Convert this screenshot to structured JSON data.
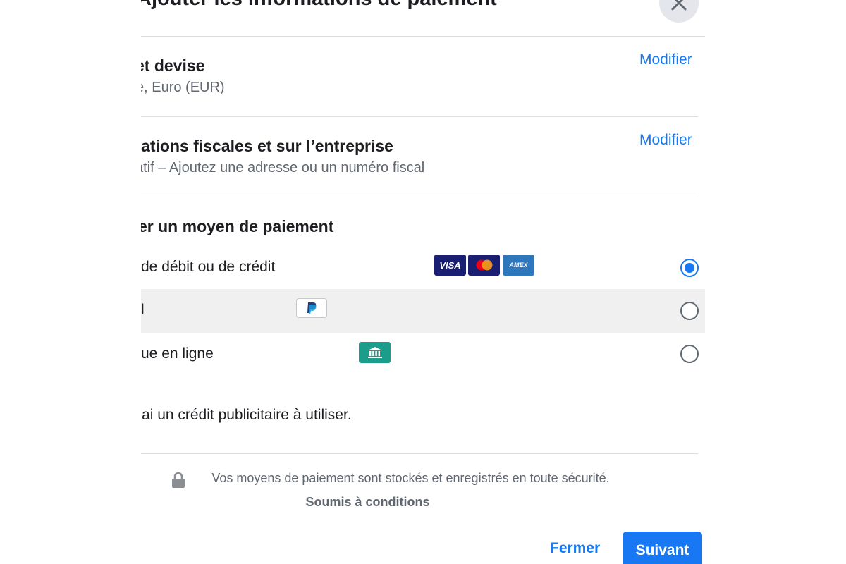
{
  "dialog": {
    "title": "Ajouter les informations de paiement",
    "close_icon": "close-icon"
  },
  "sections": {
    "currency": {
      "title": "et devise",
      "subtitle": "e, Euro (EUR)",
      "modify_label": "Modifier"
    },
    "tax": {
      "title": "nations fiscales et sur l’entreprise",
      "subtitle": "atif – Ajoutez une adresse ou un numéro fiscal",
      "modify_label": "Modifier"
    },
    "payment": {
      "title": "er un moyen de paiement",
      "options": [
        {
          "label": "de débit ou de crédit",
          "selected": true,
          "badges": [
            "VISA",
            "mastercard",
            "AMEX"
          ]
        },
        {
          "label": "l",
          "selected": false,
          "badges": [
            "paypal"
          ]
        },
        {
          "label": "ue en ligne",
          "selected": false,
          "badges": [
            "bank"
          ]
        }
      ]
    },
    "credit": {
      "text": "'ai un crédit publicitaire à utiliser."
    }
  },
  "security": {
    "text": "Vos moyens de paiement sont stockés et enregistrés en toute sécurité.",
    "terms_label": "Soumis à conditions",
    "lock_icon": "lock-icon"
  },
  "footer": {
    "close_label": "Fermer",
    "next_label": "Suivant"
  },
  "colors": {
    "accent": "#1877f2",
    "visa": "#1a1f71",
    "amex": "#2e77bc",
    "bank": "#1c9d8c"
  }
}
